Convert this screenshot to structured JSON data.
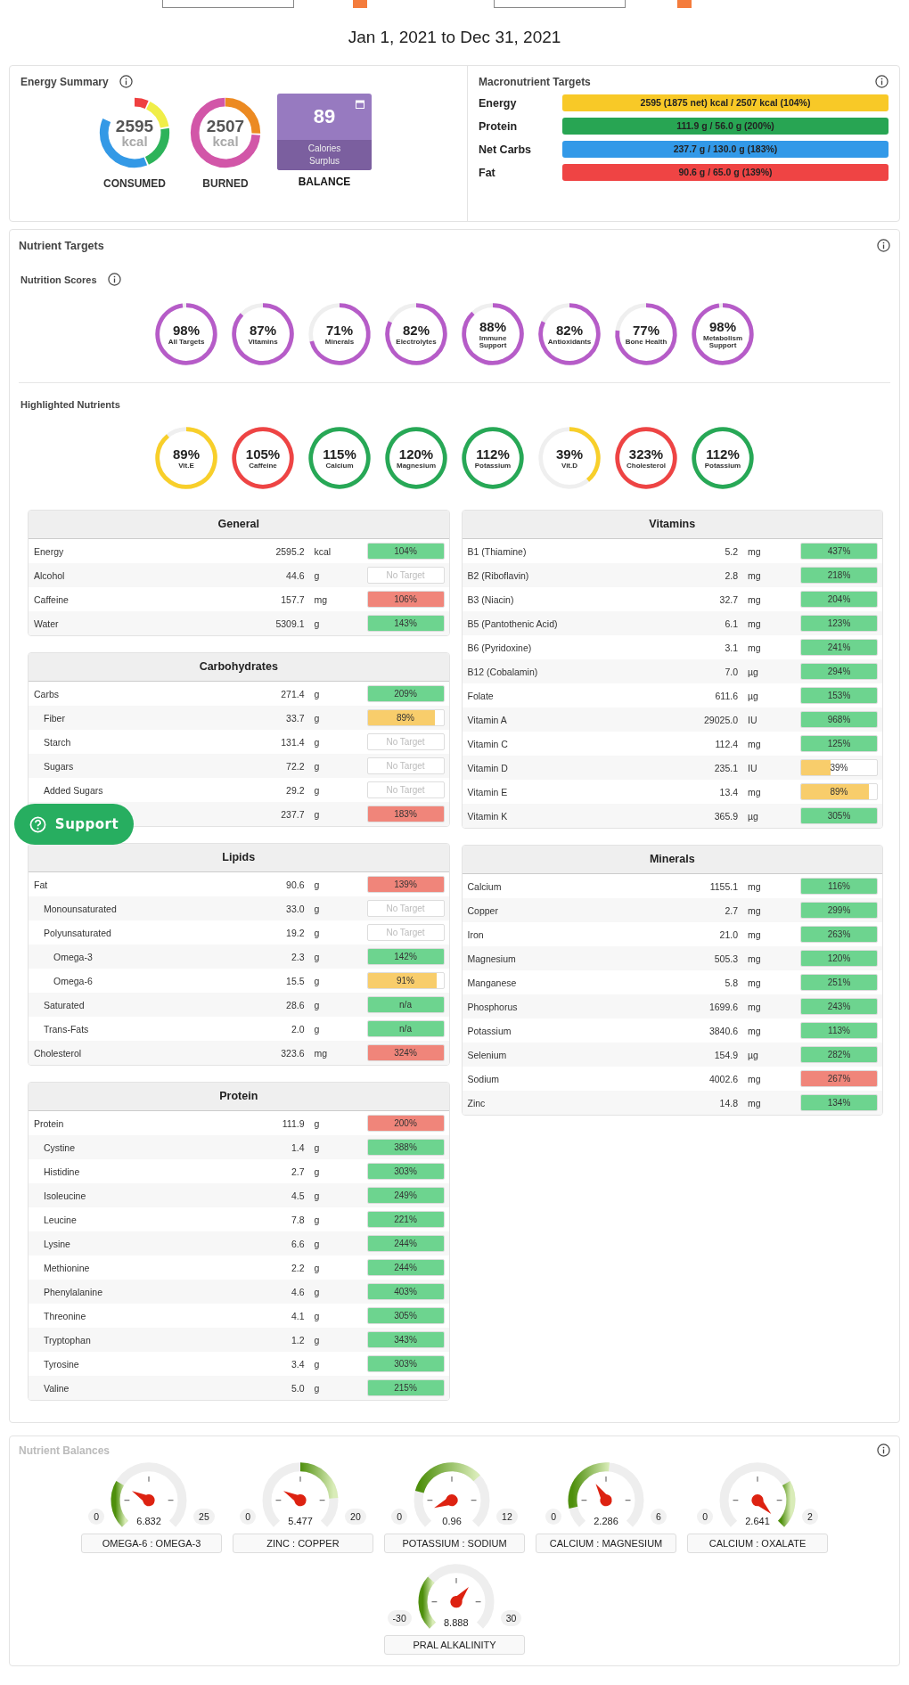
{
  "top_controls": [
    {
      "kind": "select"
    },
    {
      "kind": "checkbox",
      "checked": true
    },
    {
      "kind": "select"
    },
    {
      "kind": "checkbox",
      "checked": true
    }
  ],
  "date_range": "Jan 1, 2021 to Dec 31, 2021",
  "energy_summary": {
    "title": "Energy Summary",
    "consumed": {
      "value": "2595",
      "unit": "kcal",
      "label": "CONSUMED"
    },
    "burned": {
      "value": "2507",
      "unit": "kcal",
      "label": "BURNED"
    },
    "balance": {
      "value": "89",
      "caption": "Calories Surplus",
      "label": "BALANCE"
    }
  },
  "macronutrient_targets": {
    "title": "Macronutrient Targets",
    "bars": [
      {
        "label": "Energy",
        "text": "2595 (1875 net) kcal / 2507 kcal (104%)",
        "color": "#f8c927"
      },
      {
        "label": "Protein",
        "text": "111.9 g / 56.0 g (200%)",
        "color": "#28a553"
      },
      {
        "label": "Net Carbs",
        "text": "237.7 g / 130.0 g (183%)",
        "color": "#3299e8"
      },
      {
        "label": "Fat",
        "text": "90.6 g / 65.0 g (139%)",
        "color": "#ef4444"
      }
    ]
  },
  "nutrient_targets": {
    "title": "Nutrient Targets",
    "scores": {
      "title": "Nutrition Scores",
      "items": [
        {
          "value": "98%",
          "label": "All Targets"
        },
        {
          "value": "87%",
          "label": "Vitamins"
        },
        {
          "value": "71%",
          "label": "Minerals"
        },
        {
          "value": "82%",
          "label": "Electrolytes"
        },
        {
          "value": "88%",
          "label": "Immune Support"
        },
        {
          "value": "82%",
          "label": "Antioxidants"
        },
        {
          "value": "77%",
          "label": "Bone Health"
        },
        {
          "value": "98%",
          "label": "Metabolism Support"
        }
      ]
    },
    "highlighted": {
      "title": "Highlighted Nutrients",
      "items": [
        {
          "value": "89%",
          "label": "Vit.E",
          "color": "#f8cf2a"
        },
        {
          "value": "105%",
          "label": "Caffeine",
          "color": "#ee4444"
        },
        {
          "value": "115%",
          "label": "Calcium",
          "color": "#27a856"
        },
        {
          "value": "120%",
          "label": "Magnesium",
          "color": "#27a856"
        },
        {
          "value": "112%",
          "label": "Potassium",
          "color": "#27a856"
        },
        {
          "value": "39%",
          "label": "Vit.D",
          "color": "#f8cf2a"
        },
        {
          "value": "323%",
          "label": "Cholesterol",
          "color": "#ee4444"
        },
        {
          "value": "112%",
          "label": "Potassium",
          "color": "#27a856"
        }
      ]
    },
    "tables_left": [
      {
        "title": "General",
        "rows": [
          {
            "name": "Energy",
            "amount": "2595.2",
            "unit": "kcal",
            "target": {
              "kind": "percent",
              "text": "104%",
              "level": 1,
              "color": "#6dd48f"
            }
          },
          {
            "name": "Alcohol",
            "amount": "44.6",
            "unit": "g",
            "target": {
              "kind": "none",
              "text": "No Target"
            }
          },
          {
            "name": "Caffeine",
            "amount": "157.7",
            "unit": "mg",
            "target": {
              "kind": "percent",
              "text": "106%",
              "level": 1,
              "color": "#f0857a"
            }
          },
          {
            "name": "Water",
            "amount": "5309.1",
            "unit": "g",
            "target": {
              "kind": "percent",
              "text": "143%",
              "level": 1,
              "color": "#6dd48f"
            }
          }
        ]
      },
      {
        "title": "Carbohydrates",
        "rows": [
          {
            "name": "Carbs",
            "amount": "271.4",
            "unit": "g",
            "target": {
              "kind": "percent",
              "text": "209%",
              "level": 1,
              "color": "#6dd48f"
            },
            "children": [
              {
                "name": "Fiber",
                "amount": "33.7",
                "unit": "g",
                "target": {
                  "kind": "percent",
                  "text": "89%",
                  "level": 0.89,
                  "color": "#f8cd6b"
                }
              },
              {
                "name": "Starch",
                "amount": "131.4",
                "unit": "g",
                "target": {
                  "kind": "none",
                  "text": "No Target"
                }
              },
              {
                "name": "Sugars",
                "amount": "72.2",
                "unit": "g",
                "target": {
                  "kind": "none",
                  "text": "No Target"
                }
              },
              {
                "name": "Added Sugars",
                "amount": "29.2",
                "unit": "g",
                "target": {
                  "kind": "none",
                  "text": "No Target"
                }
              },
              {
                "amount": "237.7",
                "unit": "g",
                "target": {
                  "kind": "percent",
                  "text": "183%",
                  "level": 1,
                  "color": "#f0857a"
                }
              }
            ]
          }
        ]
      },
      {
        "title": "Lipids",
        "rows": [
          {
            "name": "Fat",
            "amount": "90.6",
            "unit": "g",
            "target": {
              "kind": "percent",
              "text": "139%",
              "level": 1,
              "color": "#f0857a"
            },
            "children": [
              {
                "name": "Monounsaturated",
                "amount": "33.0",
                "unit": "g",
                "target": {
                  "kind": "none",
                  "text": "No Target"
                }
              },
              {
                "name": "Polyunsaturated",
                "amount": "19.2",
                "unit": "g",
                "target": {
                  "kind": "none",
                  "text": "No Target"
                },
                "children": [
                  {
                    "name": "Omega-3",
                    "amount": "2.3",
                    "unit": "g",
                    "target": {
                      "kind": "percent",
                      "text": "142%",
                      "level": 1,
                      "color": "#6dd48f"
                    }
                  },
                  {
                    "name": "Omega-6",
                    "amount": "15.5",
                    "unit": "g",
                    "target": {
                      "kind": "percent",
                      "text": "91%",
                      "level": 0.91,
                      "color": "#f8cd6b"
                    }
                  }
                ]
              },
              {
                "name": "Saturated",
                "amount": "28.6",
                "unit": "g",
                "target": {
                  "kind": "percent",
                  "text": "n/a",
                  "level": 1,
                  "color": "#6dd48f"
                }
              },
              {
                "name": "Trans-Fats",
                "amount": "2.0",
                "unit": "g",
                "target": {
                  "kind": "percent",
                  "text": "n/a",
                  "level": 1,
                  "color": "#6dd48f"
                }
              }
            ]
          },
          {
            "name": "Cholesterol",
            "amount": "323.6",
            "unit": "mg",
            "target": {
              "kind": "percent",
              "text": "324%",
              "level": 1,
              "color": "#f0857a"
            }
          }
        ]
      },
      {
        "title": "Protein",
        "rows": [
          {
            "name": "Protein",
            "amount": "111.9",
            "unit": "g",
            "target": {
              "kind": "percent",
              "text": "200%",
              "level": 1,
              "color": "#f0857a"
            },
            "children": [
              {
                "name": "Cystine",
                "amount": "1.4",
                "unit": "g",
                "target": {
                  "kind": "percent",
                  "text": "388%",
                  "level": 1,
                  "color": "#6dd48f"
                }
              },
              {
                "name": "Histidine",
                "amount": "2.7",
                "unit": "g",
                "target": {
                  "kind": "percent",
                  "text": "303%",
                  "level": 1,
                  "color": "#6dd48f"
                }
              },
              {
                "name": "Isoleucine",
                "amount": "4.5",
                "unit": "g",
                "target": {
                  "kind": "percent",
                  "text": "249%",
                  "level": 1,
                  "color": "#6dd48f"
                }
              },
              {
                "name": "Leucine",
                "amount": "7.8",
                "unit": "g",
                "target": {
                  "kind": "percent",
                  "text": "221%",
                  "level": 1,
                  "color": "#6dd48f"
                }
              },
              {
                "name": "Lysine",
                "amount": "6.6",
                "unit": "g",
                "target": {
                  "kind": "percent",
                  "text": "244%",
                  "level": 1,
                  "color": "#6dd48f"
                }
              },
              {
                "name": "Methionine",
                "amount": "2.2",
                "unit": "g",
                "target": {
                  "kind": "percent",
                  "text": "244%",
                  "level": 1,
                  "color": "#6dd48f"
                }
              },
              {
                "name": "Phenylalanine",
                "amount": "4.6",
                "unit": "g",
                "target": {
                  "kind": "percent",
                  "text": "403%",
                  "level": 1,
                  "color": "#6dd48f"
                }
              },
              {
                "name": "Threonine",
                "amount": "4.1",
                "unit": "g",
                "target": {
                  "kind": "percent",
                  "text": "305%",
                  "level": 1,
                  "color": "#6dd48f"
                }
              },
              {
                "name": "Tryptophan",
                "amount": "1.2",
                "unit": "g",
                "target": {
                  "kind": "percent",
                  "text": "343%",
                  "level": 1,
                  "color": "#6dd48f"
                }
              },
              {
                "name": "Tyrosine",
                "amount": "3.4",
                "unit": "g",
                "target": {
                  "kind": "percent",
                  "text": "303%",
                  "level": 1,
                  "color": "#6dd48f"
                }
              },
              {
                "name": "Valine",
                "amount": "5.0",
                "unit": "g",
                "target": {
                  "kind": "percent",
                  "text": "215%",
                  "level": 1,
                  "color": "#6dd48f"
                }
              }
            ]
          }
        ]
      }
    ],
    "tables_right": [
      {
        "title": "Vitamins",
        "rows": [
          {
            "name": "B1 (Thiamine)",
            "amount": "5.2",
            "unit": "mg",
            "target": {
              "kind": "percent",
              "text": "437%",
              "level": 1,
              "color": "#6dd48f"
            }
          },
          {
            "name": "B2 (Riboflavin)",
            "amount": "2.8",
            "unit": "mg",
            "target": {
              "kind": "percent",
              "text": "218%",
              "level": 1,
              "color": "#6dd48f"
            }
          },
          {
            "name": "B3 (Niacin)",
            "amount": "32.7",
            "unit": "mg",
            "target": {
              "kind": "percent",
              "text": "204%",
              "level": 1,
              "color": "#6dd48f"
            }
          },
          {
            "name": "B5 (Pantothenic Acid)",
            "amount": "6.1",
            "unit": "mg",
            "target": {
              "kind": "percent",
              "text": "123%",
              "level": 1,
              "color": "#6dd48f"
            }
          },
          {
            "name": "B6 (Pyridoxine)",
            "amount": "3.1",
            "unit": "mg",
            "target": {
              "kind": "percent",
              "text": "241%",
              "level": 1,
              "color": "#6dd48f"
            }
          },
          {
            "name": "B12 (Cobalamin)",
            "amount": "7.0",
            "unit": "µg",
            "target": {
              "kind": "percent",
              "text": "294%",
              "level": 1,
              "color": "#6dd48f"
            }
          },
          {
            "name": "Folate",
            "amount": "611.6",
            "unit": "µg",
            "target": {
              "kind": "percent",
              "text": "153%",
              "level": 1,
              "color": "#6dd48f"
            }
          },
          {
            "name": "Vitamin A",
            "amount": "29025.0",
            "unit": "IU",
            "target": {
              "kind": "percent",
              "text": "968%",
              "level": 1,
              "color": "#6dd48f"
            }
          },
          {
            "name": "Vitamin C",
            "amount": "112.4",
            "unit": "mg",
            "target": {
              "kind": "percent",
              "text": "125%",
              "level": 1,
              "color": "#6dd48f"
            }
          },
          {
            "name": "Vitamin D",
            "amount": "235.1",
            "unit": "IU",
            "target": {
              "kind": "percent",
              "text": "39%",
              "level": 0.39,
              "color": "#f8cd6b"
            }
          },
          {
            "name": "Vitamin E",
            "amount": "13.4",
            "unit": "mg",
            "target": {
              "kind": "percent",
              "text": "89%",
              "level": 0.89,
              "color": "#f8cd6b"
            }
          },
          {
            "name": "Vitamin K",
            "amount": "365.9",
            "unit": "µg",
            "target": {
              "kind": "percent",
              "text": "305%",
              "level": 1,
              "color": "#6dd48f"
            }
          }
        ]
      },
      {
        "title": "Minerals",
        "rows": [
          {
            "name": "Calcium",
            "amount": "1155.1",
            "unit": "mg",
            "target": {
              "kind": "percent",
              "text": "116%",
              "level": 1,
              "color": "#6dd48f"
            }
          },
          {
            "name": "Copper",
            "amount": "2.7",
            "unit": "mg",
            "target": {
              "kind": "percent",
              "text": "299%",
              "level": 1,
              "color": "#6dd48f"
            }
          },
          {
            "name": "Iron",
            "amount": "21.0",
            "unit": "mg",
            "target": {
              "kind": "percent",
              "text": "263%",
              "level": 1,
              "color": "#6dd48f"
            }
          },
          {
            "name": "Magnesium",
            "amount": "505.3",
            "unit": "mg",
            "target": {
              "kind": "percent",
              "text": "120%",
              "level": 1,
              "color": "#6dd48f"
            }
          },
          {
            "name": "Manganese",
            "amount": "5.8",
            "unit": "mg",
            "target": {
              "kind": "percent",
              "text": "251%",
              "level": 1,
              "color": "#6dd48f"
            }
          },
          {
            "name": "Phosphorus",
            "amount": "1699.6",
            "unit": "mg",
            "target": {
              "kind": "percent",
              "text": "243%",
              "level": 1,
              "color": "#6dd48f"
            }
          },
          {
            "name": "Potassium",
            "amount": "3840.6",
            "unit": "mg",
            "target": {
              "kind": "percent",
              "text": "113%",
              "level": 1,
              "color": "#6dd48f"
            }
          },
          {
            "name": "Selenium",
            "amount": "154.9",
            "unit": "µg",
            "target": {
              "kind": "percent",
              "text": "282%",
              "level": 1,
              "color": "#6dd48f"
            }
          },
          {
            "name": "Sodium",
            "amount": "4002.6",
            "unit": "mg",
            "target": {
              "kind": "percent",
              "text": "267%",
              "level": 1,
              "color": "#f0857a"
            }
          },
          {
            "name": "Zinc",
            "amount": "14.8",
            "unit": "mg",
            "target": {
              "kind": "percent",
              "text": "134%",
              "level": 1,
              "color": "#6dd48f"
            }
          }
        ]
      }
    ]
  },
  "support_button": {
    "label": "Support"
  },
  "nutrient_balances": {
    "title": "Nutrient Balances",
    "gauges": [
      {
        "min": "0",
        "max": "25",
        "value": "6.832",
        "label": "OMEGA-6 : OMEGA-3"
      },
      {
        "min": "0",
        "max": "20",
        "value": "5.477",
        "label": "ZINC : COPPER"
      },
      {
        "min": "0",
        "max": "12",
        "value": "0.96",
        "label": "POTASSIUM : SODIUM"
      },
      {
        "min": "0",
        "max": "6",
        "value": "2.286",
        "label": "CALCIUM : MAGNESIUM"
      },
      {
        "min": "0",
        "max": "2",
        "value": "2.641",
        "label": "CALCIUM : OXALATE"
      },
      {
        "min": "-30",
        "max": "30",
        "value": "8.888",
        "label": "PRAL ALKALINITY"
      }
    ]
  }
}
